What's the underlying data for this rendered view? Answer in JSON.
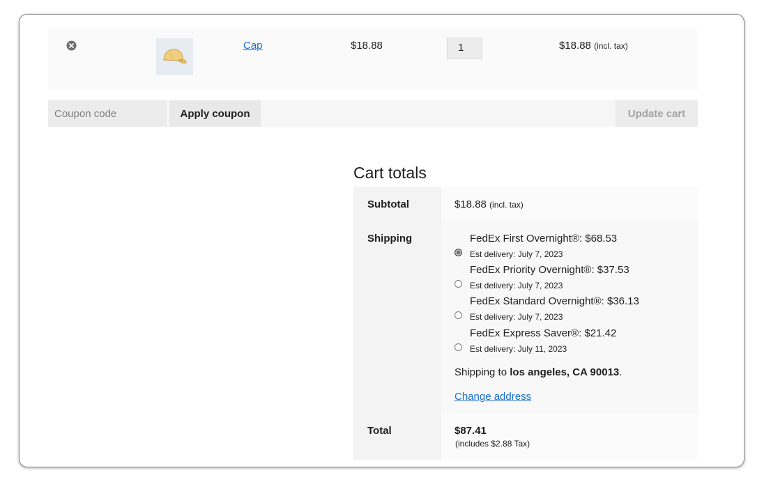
{
  "cart_item": {
    "product_name": "Cap",
    "price": "$18.88",
    "quantity": "1",
    "line_total": "$18.88",
    "line_total_suffix": "(incl. tax)"
  },
  "icons": {
    "remove": "close-circle-icon",
    "thumbnail": "cap-icon"
  },
  "coupon": {
    "placeholder": "Coupon code",
    "apply_label": "Apply coupon",
    "update_label": "Update cart"
  },
  "totals": {
    "title": "Cart totals",
    "subtotal_label": "Subtotal",
    "subtotal_value": "$18.88",
    "subtotal_suffix": "(incl. tax)",
    "shipping_label": "Shipping",
    "shipping_options": [
      {
        "label": "FedEx First Overnight®: $68.53",
        "est": "Est delivery: July 7, 2023",
        "selected": true
      },
      {
        "label": "FedEx Priority Overnight®: $37.53",
        "est": "Est delivery: July 7, 2023",
        "selected": false
      },
      {
        "label": "FedEx Standard Overnight®: $36.13",
        "est": "Est delivery: July 7, 2023",
        "selected": false
      },
      {
        "label": "FedEx Express Saver®: $21.42",
        "est": "Est delivery: July 11, 2023",
        "selected": false
      }
    ],
    "shipping_to_prefix": "Shipping to",
    "shipping_to_address": "los angeles, CA 90013",
    "shipping_to_suffix": ".",
    "change_address_label": "Change address",
    "total_label": "Total",
    "total_value": "$87.41",
    "tax_note": "(includes $2.88 Tax)"
  },
  "colors": {
    "link": "#1a6fcf",
    "text": "#1e1e1e",
    "disabled_text": "#a3a3a3"
  }
}
